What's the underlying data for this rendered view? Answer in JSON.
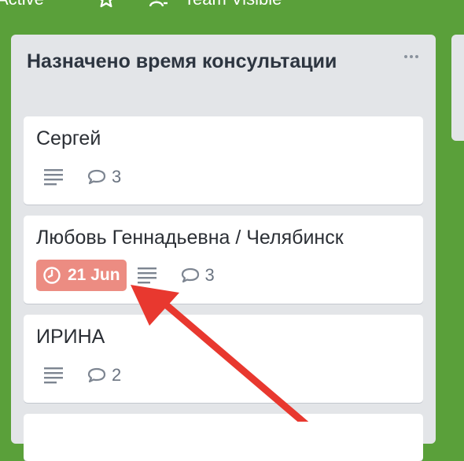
{
  "topbar": {
    "visibility_left": "Active",
    "star_icon": "star-icon",
    "team_icon": "team-icon",
    "visibility_label": "Team Visible"
  },
  "list": {
    "title": "Назначено время консультации",
    "menu_icon": "more-horizontal-icon",
    "cards": [
      {
        "title": "Сергей",
        "has_description": true,
        "comments": "3"
      },
      {
        "title": "Любовь Геннадьевна / Челябинск",
        "due": "21 Jun",
        "due_color": "#ec8c82",
        "has_description": true,
        "comments": "3"
      },
      {
        "title": "ИРИНА",
        "has_description": true,
        "comments": "2"
      }
    ]
  },
  "annotation": {
    "arrow_color": "#e8382f"
  }
}
